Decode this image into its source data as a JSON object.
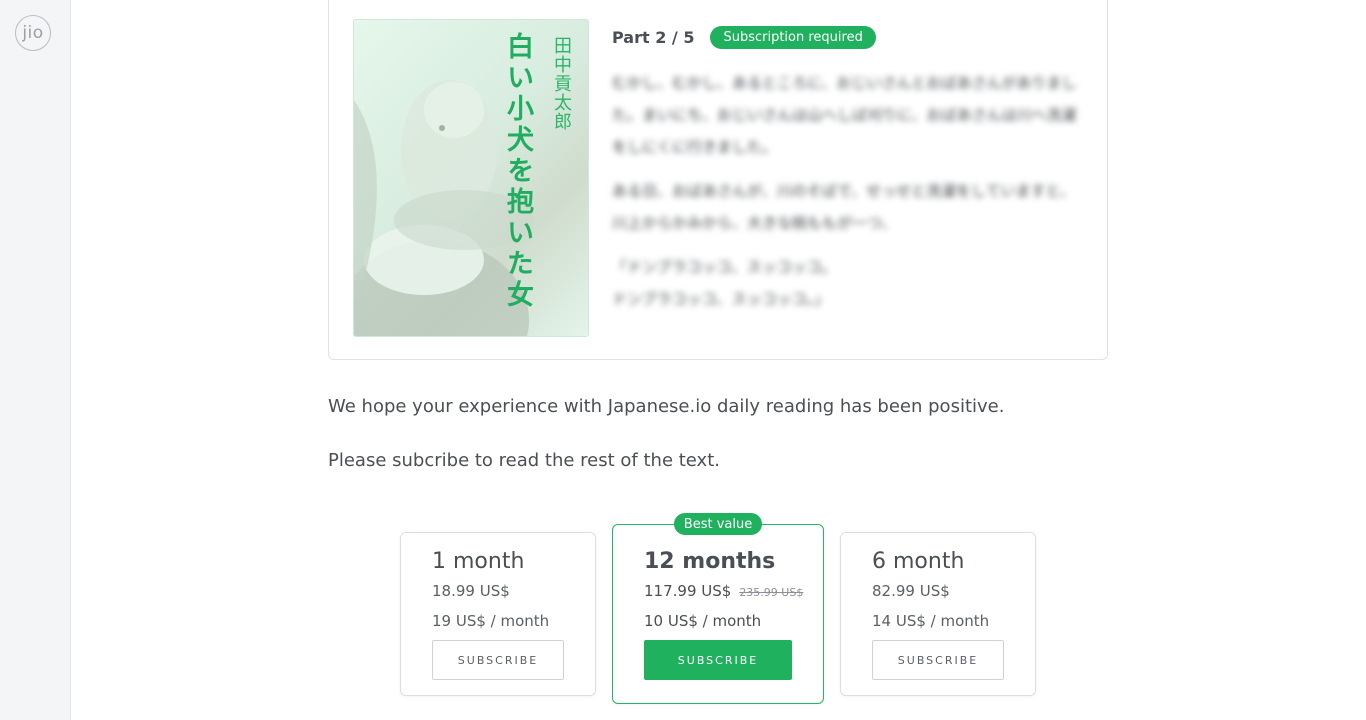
{
  "app": {
    "logo_text": "jio"
  },
  "preview": {
    "cover_title": "白い小犬を抱いた女",
    "cover_author": "田中貢太郎",
    "part_label": "Part 2 / 5",
    "badge": "Subscription required",
    "paragraphs": [
      "むかし、むかし、あるところに、おじいさんとおばあさんがありました。まいにち、おじいさんは山へしば刈りに、おばあさんは川へ洗濯をしにくに行きました。",
      "ある日、おばあさんが、川のそばで、せっせと洗濯をしていますと、川上からかみから、大きな桃ももが一つ、",
      "「ドンブラコッコ、スッコッコ。",
      "ドンブラコッコ、スッコッコ。」"
    ]
  },
  "messages": {
    "line1": "We hope your experience with Japanese.io daily reading has been positive.",
    "line2": "Please subcribe to read the rest of the text."
  },
  "plans": [
    {
      "name": "1 month",
      "price": "18.99 US$",
      "old_price": "",
      "monthly": "19 US$ / month",
      "button": "SUBSCRIBE"
    },
    {
      "name": "12 months",
      "price": "117.99 US$",
      "old_price": "235.99 US$",
      "monthly": "10 US$ / month",
      "button": "SUBSCRIBE",
      "badge": "Best value"
    },
    {
      "name": "6 month",
      "price": "82.99 US$",
      "old_price": "",
      "monthly": "14 US$ / month",
      "button": "SUBSCRIBE"
    }
  ],
  "colors": {
    "accent": "#1fb15e",
    "sidebar_bg": "#f4f5f7",
    "text": "#4a4f55"
  }
}
